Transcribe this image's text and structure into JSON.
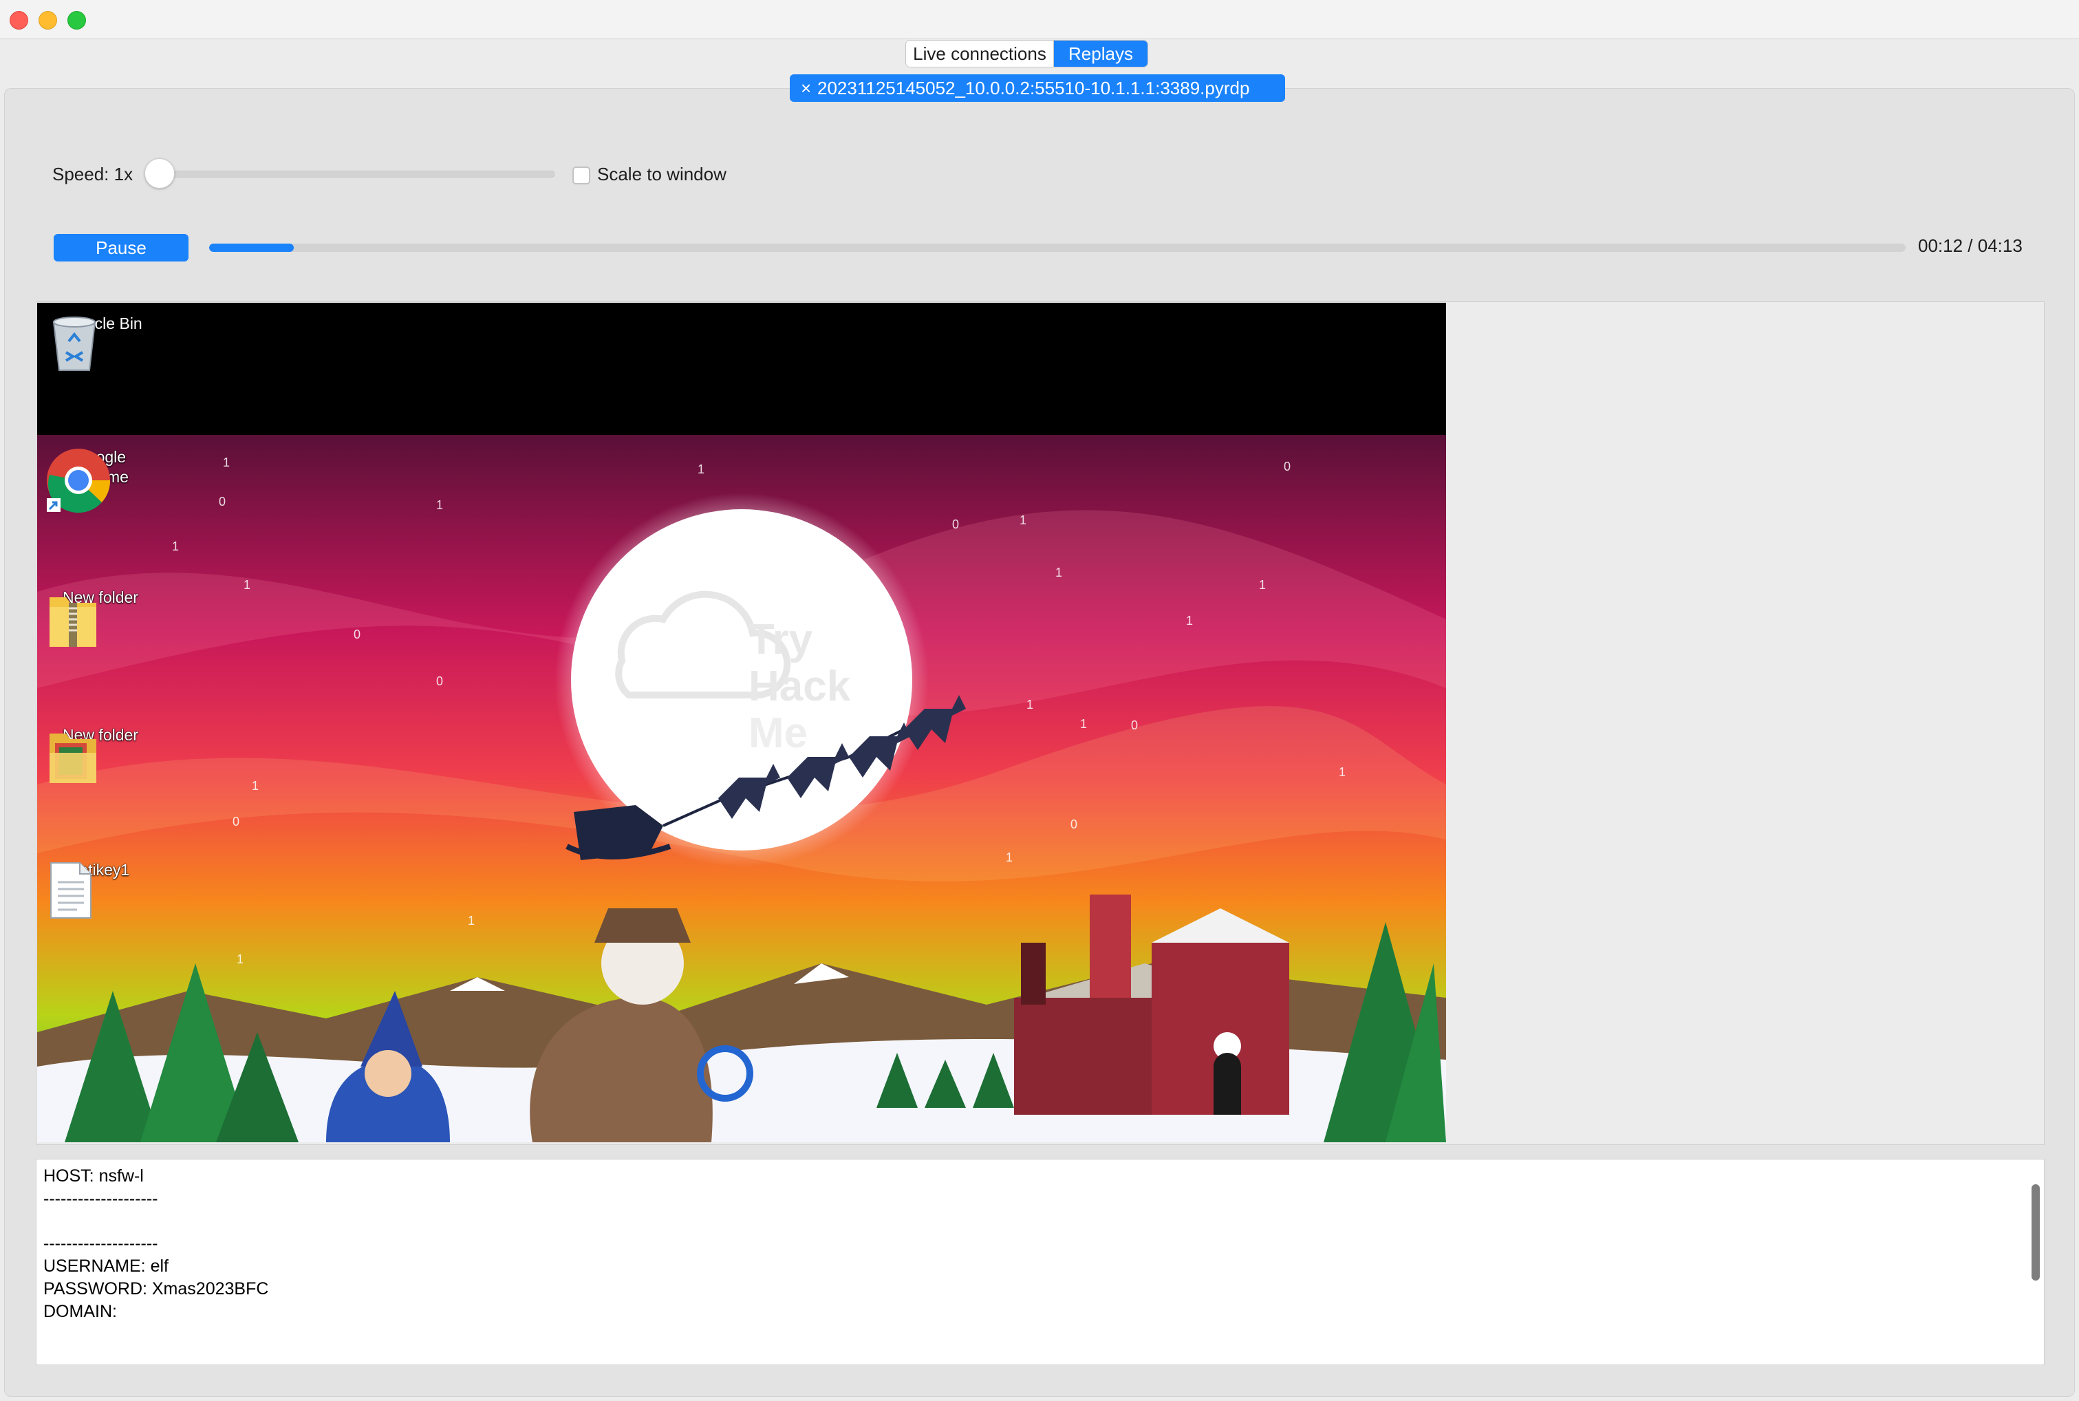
{
  "window": {
    "controls": [
      "close",
      "minimize",
      "maximize"
    ]
  },
  "tabs": [
    {
      "label": "Live connections",
      "active": false
    },
    {
      "label": "Replays",
      "active": true
    }
  ],
  "replay_tab": {
    "close_symbol": "×",
    "filename": "20231125145052_10.0.0.2:55510-10.1.1.1:3389.pyrdp"
  },
  "controls": {
    "speed_label": "Speed: 1x",
    "speed_value": 1,
    "scale_label": "Scale to window",
    "scale_checked": false,
    "pause_label": "Pause",
    "progress_fraction": 0.05,
    "time_text": "00:12 / 04:13"
  },
  "desktop": {
    "icons": [
      {
        "label": "Recycle Bin",
        "icon": "recycle-bin-icon"
      },
      {
        "label_line1": "Google",
        "label_line2": "Chrome",
        "icon": "chrome-icon"
      },
      {
        "label": "New folder",
        "icon": "zip-folder-icon"
      },
      {
        "label": "New folder",
        "icon": "folder-icon"
      },
      {
        "label": "yetikey1",
        "icon": "text-file-icon"
      }
    ],
    "wallpaper_text": {
      "line1": "Try",
      "line2": "Hack",
      "line3": "Me"
    }
  },
  "log": {
    "lines": [
      "HOST: nsfw-l",
      "",
      "--------------------",
      "",
      "--------------------",
      "USERNAME: elf",
      "PASSWORD: Xmas2023BFC",
      "DOMAIN:"
    ]
  },
  "colors": {
    "accent": "#1a82fb",
    "background": "#ececec"
  }
}
